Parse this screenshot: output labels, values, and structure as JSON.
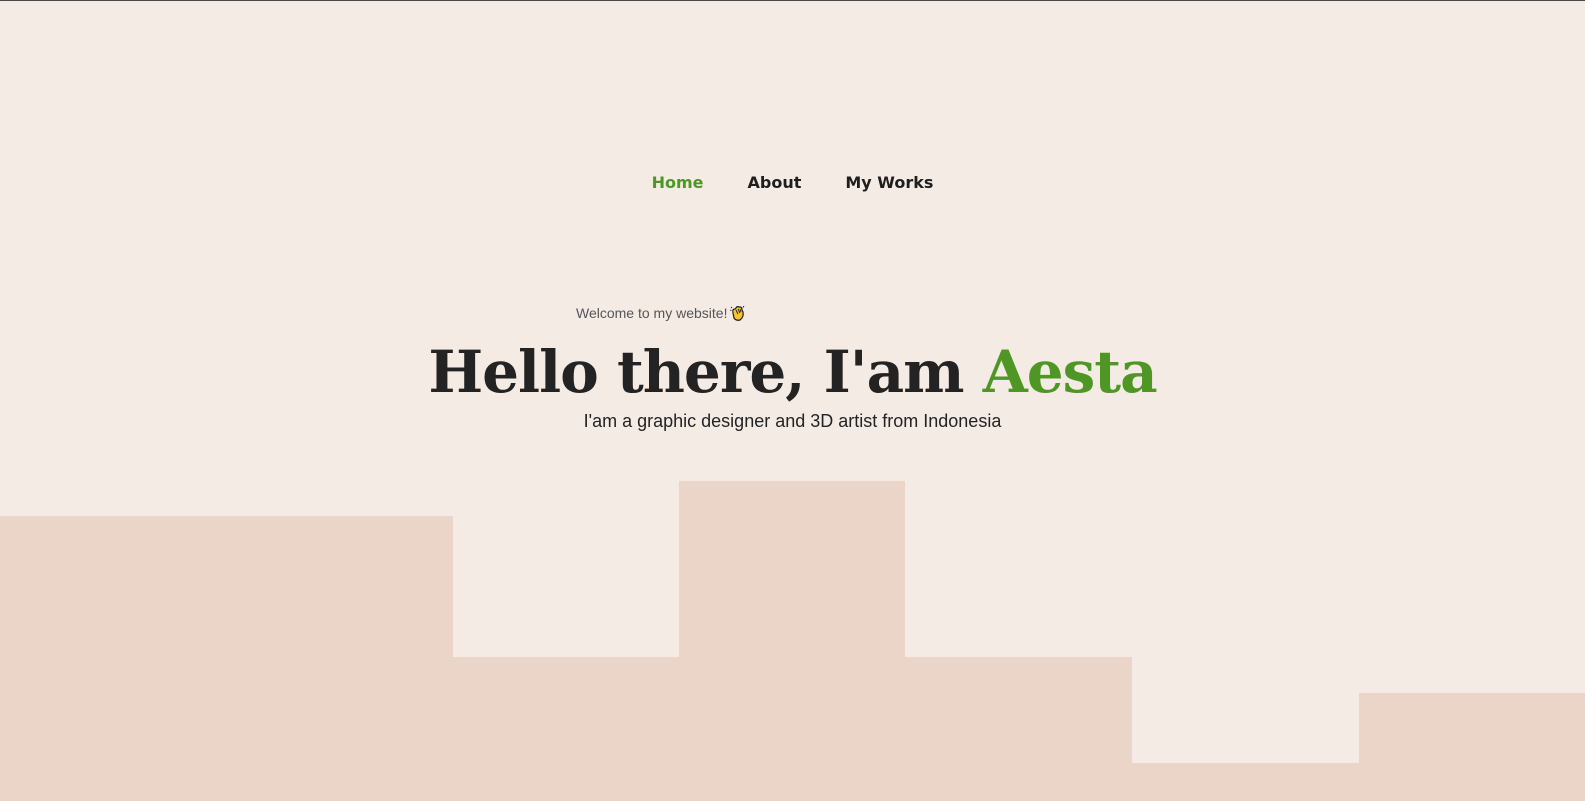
{
  "nav": {
    "items": [
      {
        "label": "Home",
        "active": true
      },
      {
        "label": "About",
        "active": false
      },
      {
        "label": "My Works",
        "active": false
      }
    ]
  },
  "hero": {
    "welcome": "Welcome to my website!",
    "wave_icon": "waving-hand-icon",
    "title_prefix": "Hello there, I'am ",
    "title_name": "Aesta",
    "subtitle": "I'am a graphic designer and 3D artist from Indonesia"
  },
  "colors": {
    "background": "#F5EBE5",
    "accent": "#4E9725",
    "text": "#232323",
    "blocks": "#EAD5C8"
  }
}
